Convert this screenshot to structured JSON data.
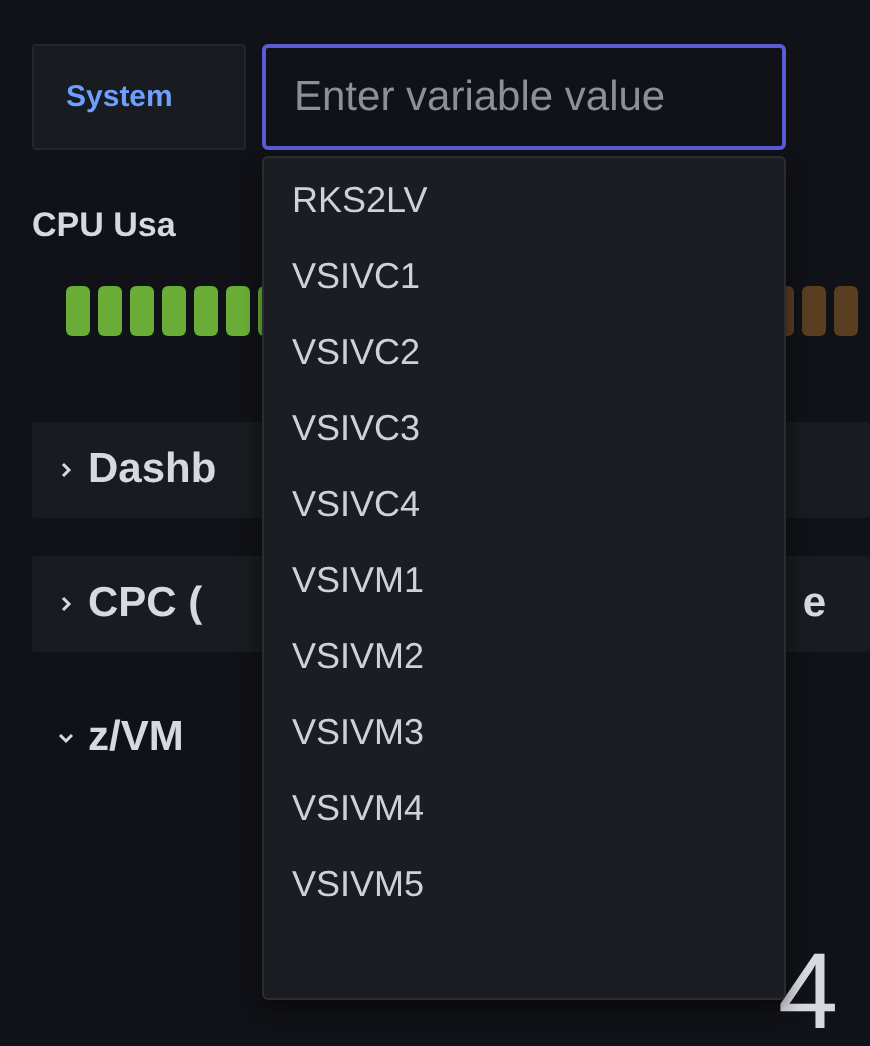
{
  "variable": {
    "label": "System",
    "placeholder": "Enter variable value"
  },
  "dropdown": {
    "options": [
      "RKS2LV",
      "VSIVC1",
      "VSIVC2",
      "VSIVC3",
      "VSIVC4",
      "VSIVM1",
      "VSIVM2",
      "VSIVM3",
      "VSIVM4",
      "VSIVM5"
    ]
  },
  "panel": {
    "title": "CPU Usa"
  },
  "rows": [
    {
      "title": "Dashb",
      "expanded": false
    },
    {
      "title": "CPC (",
      "expanded": false,
      "trailing": "e"
    },
    {
      "title": "z/VM",
      "expanded": true
    }
  ],
  "stat": {
    "value": "4"
  }
}
